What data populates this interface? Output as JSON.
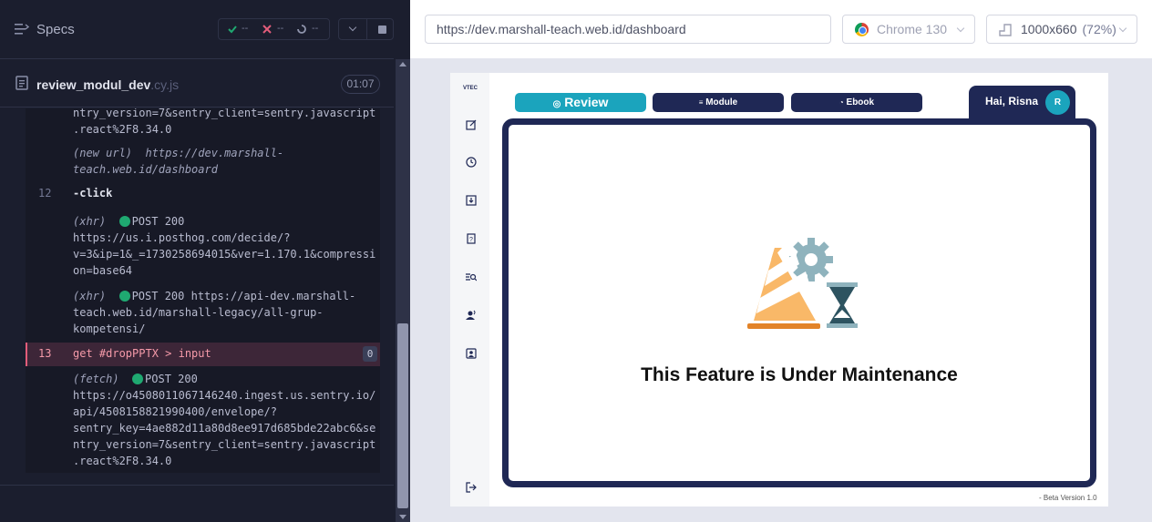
{
  "reporter": {
    "specs_label": "Specs",
    "stats": {
      "passed": "--",
      "failed": "--",
      "pending": "--"
    },
    "spec": {
      "name": "review_modul_dev",
      "ext": ".cy.js",
      "time": "01:07"
    },
    "log": {
      "entry_top_text": "ntry_version=7&sentry_client=sentry.javascript\n.react%2F8.34.0",
      "new_url_prefix": "(new url)",
      "new_url_text": "https://dev.marshall-\nteach.web.id/dashboard",
      "step12_num": "12",
      "step12_cmd": "-click",
      "xhr1_prefix": "(xhr)",
      "xhr1_text": "POST 200\nhttps://us.i.posthog.com/decide/?\nv=3&ip=1&_=1730258694015&ver=1.170.1&compressi\non=base64",
      "xhr2_prefix": "(xhr)",
      "xhr2_text": "POST 200 https://api-dev.marshall-\nteach.web.id/marshall-legacy/all-grup-\nkompetensi/",
      "step13_num": "13",
      "step13_cmd": "get  #dropPPTX > input",
      "step13_badge": "0",
      "fetch_prefix": "(fetch)",
      "fetch_text": "POST 200\nhttps://o4508011067146240.ingest.us.sentry.io/\napi/4508158821990400/envelope/?\nsentry_key=4ae882d11a80d8ee917d685bde22abc6&se\nntry_version=7&sentry_client=sentry.javascript\n.react%2F8.34.0"
    }
  },
  "runner": {
    "url": "https://dev.marshall-teach.web.id/dashboard",
    "browser": "Chrome 130",
    "viewport": "1000x660",
    "zoom": "(72%)"
  },
  "app": {
    "logo_text": "VTEC",
    "tabs": {
      "review": "Review",
      "module": "Module",
      "ebook": "Ebook"
    },
    "greeting": "Hai, Risna",
    "avatar_initial": "R",
    "maintenance_title": "This Feature is Under Maintenance",
    "beta": "- Beta Version 1.0"
  },
  "colors": {
    "navy": "#1f2855",
    "teal": "#1ba4bd",
    "pass_green": "#1fa971",
    "fail_red": "#e25c7a"
  }
}
